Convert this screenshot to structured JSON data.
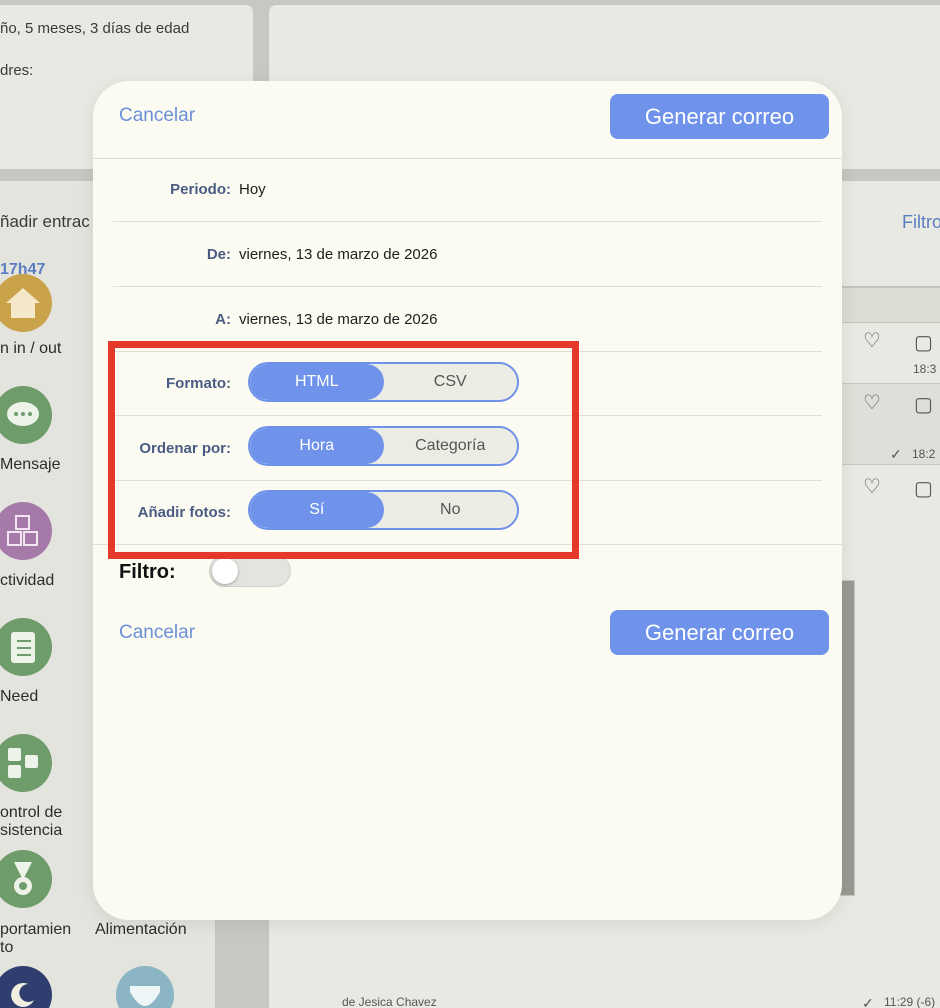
{
  "background": {
    "child_info": "ño, 5 meses, 3 días de edad",
    "parents_label": "dres:",
    "add_entry": "ñadir entrac",
    "time": "17h47",
    "filter_link": "Filtro",
    "categories": [
      "n in / out",
      "Mensaje",
      "ctividad",
      "Need",
      "ontrol de\nsistencia",
      "portamien\nto",
      "Alimentación"
    ],
    "times": [
      "18:3",
      "18:2",
      "11:29 (-6)"
    ],
    "author": "de Jesica Chavez"
  },
  "modal": {
    "cancel_label": "Cancelar",
    "generate_label": "Generar correo",
    "rows": {
      "periodo": {
        "label": "Periodo:",
        "value": "Hoy"
      },
      "de": {
        "label": "De:",
        "value": "viernes, 13 de marzo de 2026"
      },
      "a": {
        "label": "A:",
        "value": "viernes, 13 de marzo de 2026"
      },
      "formato": {
        "label": "Formato:",
        "options": [
          "HTML",
          "CSV"
        ],
        "selected": "HTML"
      },
      "ordenar": {
        "label": "Ordenar por:",
        "options": [
          "Hora",
          "Categoría"
        ],
        "selected": "Hora"
      },
      "fotos": {
        "label": "Añadir fotos:",
        "options": [
          "Sí",
          "No"
        ],
        "selected": "Sí"
      }
    },
    "filter_label": "Filtro:",
    "filter_on": false
  },
  "colors": {
    "accent": "#6f92ea",
    "highlight": "#e4392a",
    "label": "#4a5c84"
  }
}
